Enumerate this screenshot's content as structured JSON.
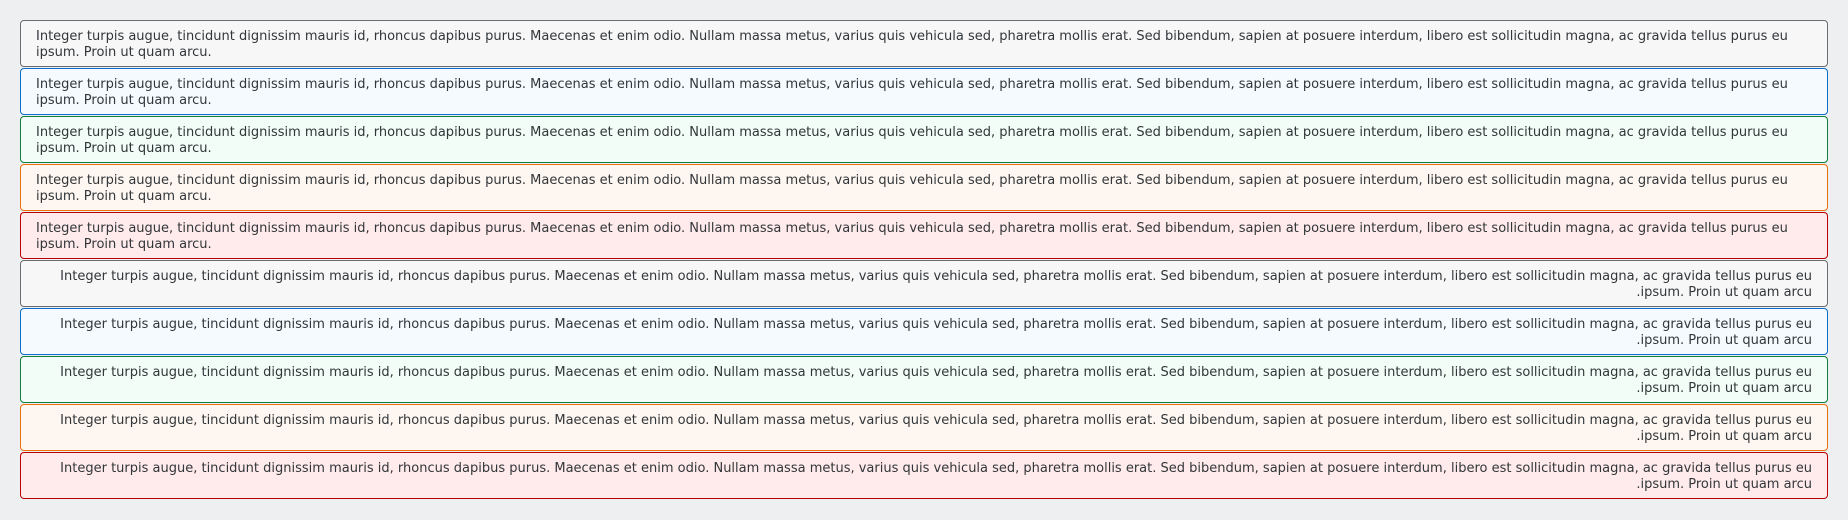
{
  "strips": [
    {
      "type": "neutral",
      "dir": "ltr",
      "text": "Integer turpis augue, tincidunt dignissim mauris id, rhoncus dapibus purus. Maecenas et enim odio. Nullam massa metus, varius quis vehicula sed, pharetra mollis erat. Sed bibendum, sapien at posuere interdum, libero est sollicitudin magna, ac gravida tellus purus eu ipsum. Proin ut quam arcu."
    },
    {
      "type": "information",
      "dir": "ltr",
      "text": "Integer turpis augue, tincidunt dignissim mauris id, rhoncus dapibus purus. Maecenas et enim odio. Nullam massa metus, varius quis vehicula sed, pharetra mollis erat. Sed bibendum, sapien at posuere interdum, libero est sollicitudin magna, ac gravida tellus purus eu ipsum. Proin ut quam arcu."
    },
    {
      "type": "success",
      "dir": "ltr",
      "text": "Integer turpis augue, tincidunt dignissim mauris id, rhoncus dapibus purus. Maecenas et enim odio. Nullam massa metus, varius quis vehicula sed, pharetra mollis erat. Sed bibendum, sapien at posuere interdum, libero est sollicitudin magna, ac gravida tellus purus eu ipsum. Proin ut quam arcu."
    },
    {
      "type": "warning",
      "dir": "ltr",
      "text": "Integer turpis augue, tincidunt dignissim mauris id, rhoncus dapibus purus. Maecenas et enim odio. Nullam massa metus, varius quis vehicula sed, pharetra mollis erat. Sed bibendum, sapien at posuere interdum, libero est sollicitudin magna, ac gravida tellus purus eu ipsum. Proin ut quam arcu."
    },
    {
      "type": "error",
      "dir": "ltr",
      "text": "Integer turpis augue, tincidunt dignissim mauris id, rhoncus dapibus purus. Maecenas et enim odio. Nullam massa metus, varius quis vehicula sed, pharetra mollis erat. Sed bibendum, sapien at posuere interdum, libero est sollicitudin magna, ac gravida tellus purus eu ipsum. Proin ut quam arcu."
    },
    {
      "type": "neutral",
      "dir": "rtl",
      "text": "Integer turpis augue, tincidunt dignissim mauris id, rhoncus dapibus purus. Maecenas et enim odio. Nullam massa metus, varius quis vehicula sed, pharetra mollis erat. Sed bibendum, sapien at posuere interdum, libero est sollicitudin magna, ac gravida tellus purus eu ipsum. Proin ut quam arcu."
    },
    {
      "type": "information",
      "dir": "rtl",
      "text": "Integer turpis augue, tincidunt dignissim mauris id, rhoncus dapibus purus. Maecenas et enim odio. Nullam massa metus, varius quis vehicula sed, pharetra mollis erat. Sed bibendum, sapien at posuere interdum, libero est sollicitudin magna, ac gravida tellus purus eu ipsum. Proin ut quam arcu."
    },
    {
      "type": "success",
      "dir": "rtl",
      "text": "Integer turpis augue, tincidunt dignissim mauris id, rhoncus dapibus purus. Maecenas et enim odio. Nullam massa metus, varius quis vehicula sed, pharetra mollis erat. Sed bibendum, sapien at posuere interdum, libero est sollicitudin magna, ac gravida tellus purus eu ipsum. Proin ut quam arcu."
    },
    {
      "type": "warning",
      "dir": "rtl",
      "text": "Integer turpis augue, tincidunt dignissim mauris id, rhoncus dapibus purus. Maecenas et enim odio. Nullam massa metus, varius quis vehicula sed, pharetra mollis erat. Sed bibendum, sapien at posuere interdum, libero est sollicitudin magna, ac gravida tellus purus eu ipsum. Proin ut quam arcu."
    },
    {
      "type": "error",
      "dir": "rtl",
      "text": "Integer turpis augue, tincidunt dignissim mauris id, rhoncus dapibus purus. Maecenas et enim odio. Nullam massa metus, varius quis vehicula sed, pharetra mollis erat. Sed bibendum, sapien at posuere interdum, libero est sollicitudin magna, ac gravida tellus purus eu ipsum. Proin ut quam arcu."
    }
  ],
  "colors": {
    "neutral": {
      "background": "#f7f7f7",
      "border": "#6a6d70"
    },
    "information": {
      "background": "#f5faff",
      "border": "#0a6ed1"
    },
    "success": {
      "background": "#f1fdf6",
      "border": "#107e3e"
    },
    "warning": {
      "background": "#fef7f1",
      "border": "#e9730c"
    },
    "error": {
      "background": "#ffebeb",
      "border": "#bb0000"
    },
    "text": "#32363a",
    "page_background": "#eeeff1"
  }
}
